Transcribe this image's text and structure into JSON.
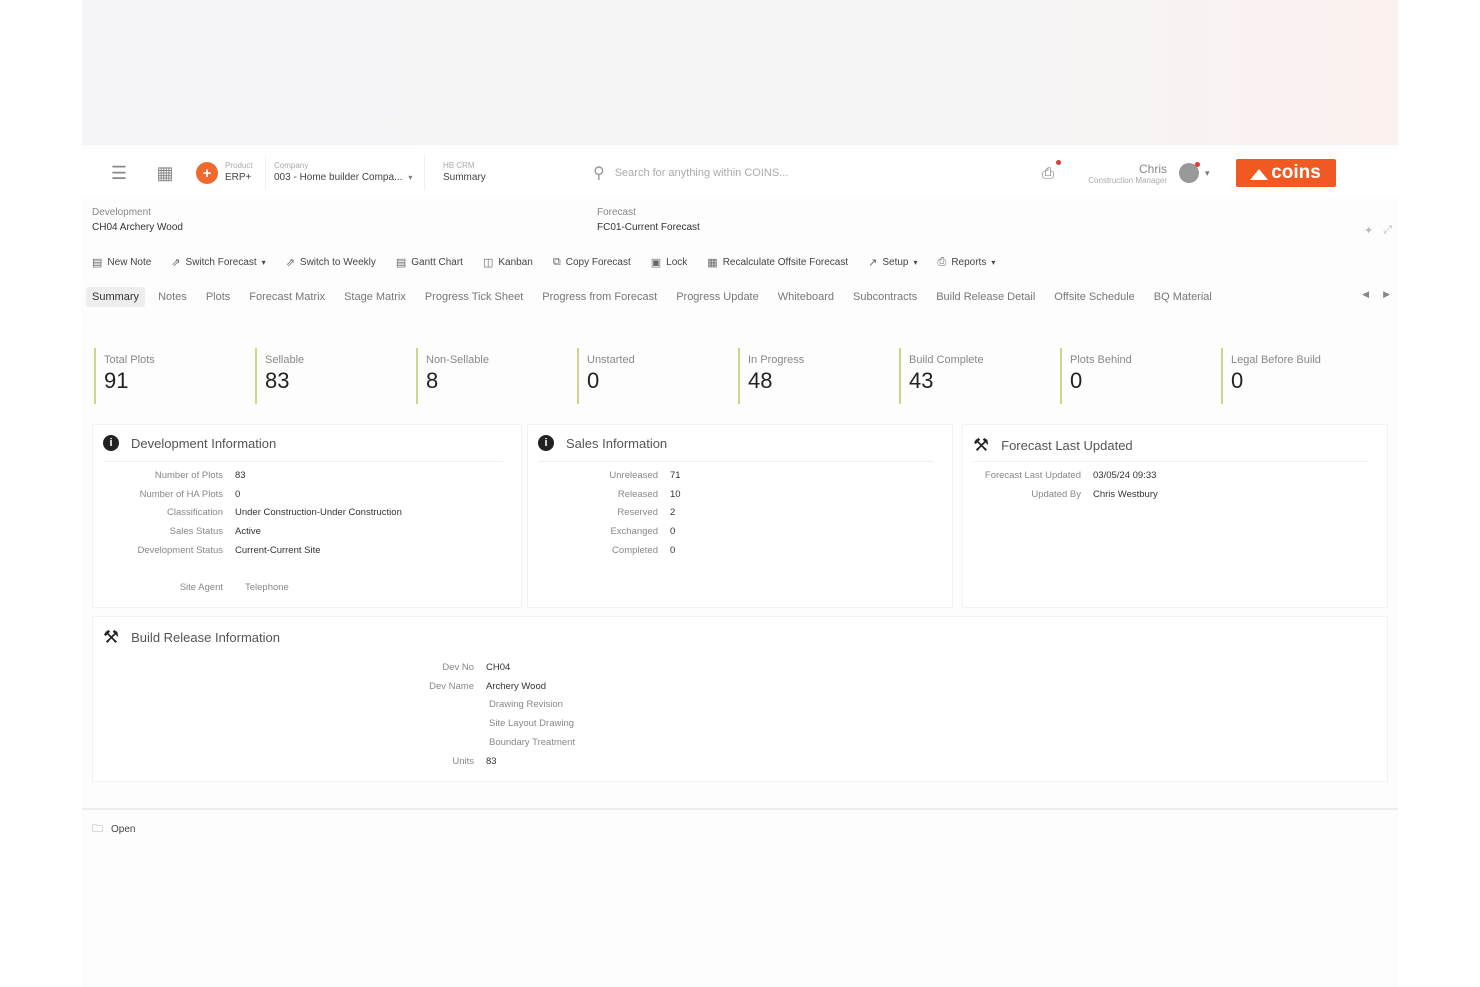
{
  "header": {
    "product_label": "Product",
    "product_value": "ERP+",
    "company_label": "Company",
    "company_value": "003 - Home builder Compa...",
    "crm_label": "HB CRM",
    "crm_value": "Summary",
    "search_placeholder": "Search for anything within COINS...",
    "user_name": "Chris",
    "user_role": "Construction Manager",
    "logo_text": "coins",
    "brand_color": "#f05a22"
  },
  "context": {
    "development_label": "Development",
    "development_value": "CH04 Archery Wood",
    "forecast_label": "Forecast",
    "forecast_value": "FC01-Current Forecast"
  },
  "toolbar": [
    {
      "label": "New Note",
      "icon": "note-icon"
    },
    {
      "label": "Switch Forecast",
      "icon": "external-link-icon",
      "caret": true
    },
    {
      "label": "Switch to Weekly",
      "icon": "external-link-icon"
    },
    {
      "label": "Gantt Chart",
      "icon": "gantt-icon"
    },
    {
      "label": "Kanban",
      "icon": "kanban-icon"
    },
    {
      "label": "Copy Forecast",
      "icon": "copy-icon"
    },
    {
      "label": "Lock",
      "icon": "lock-icon"
    },
    {
      "label": "Recalculate Offsite Forecast",
      "icon": "calculator-icon"
    },
    {
      "label": "Setup",
      "icon": "wrench-icon",
      "caret": true
    },
    {
      "label": "Reports",
      "icon": "print-icon",
      "caret": true
    }
  ],
  "tabs": [
    "Summary",
    "Notes",
    "Plots",
    "Forecast Matrix",
    "Stage Matrix",
    "Progress Tick Sheet",
    "Progress from Forecast",
    "Progress Update",
    "Whiteboard",
    "Subcontracts",
    "Build Release Detail",
    "Offsite Schedule",
    "BQ Material"
  ],
  "stats": [
    {
      "label": "Total Plots",
      "value": "91"
    },
    {
      "label": "Sellable",
      "value": "83"
    },
    {
      "label": "Non-Sellable",
      "value": "8"
    },
    {
      "label": "Unstarted",
      "value": "0"
    },
    {
      "label": "In Progress",
      "value": "48"
    },
    {
      "label": "Build Complete",
      "value": "43"
    },
    {
      "label": "Plots Behind",
      "value": "0"
    },
    {
      "label": "Legal Before Build",
      "value": "0"
    }
  ],
  "development_info": {
    "title": "Development Information",
    "rows": [
      {
        "k": "Number of Plots",
        "v": "83"
      },
      {
        "k": "Number of HA Plots",
        "v": "0"
      },
      {
        "k": "Classification",
        "v": "Under Construction-Under Construction"
      },
      {
        "k": "Sales Status",
        "v": "Active"
      },
      {
        "k": "Development Status",
        "v": "Current-Current Site"
      }
    ],
    "site_agent_label": "Site Agent",
    "telephone_label": "Telephone"
  },
  "sales_info": {
    "title": "Sales Information",
    "rows": [
      {
        "k": "Unreleased",
        "v": "71"
      },
      {
        "k": "Released",
        "v": "10"
      },
      {
        "k": "Reserved",
        "v": "2"
      },
      {
        "k": "Exchanged",
        "v": "0"
      },
      {
        "k": "Completed",
        "v": "0"
      }
    ]
  },
  "forecast_info": {
    "title": "Forecast Last Updated",
    "rows": [
      {
        "k": "Forecast Last Updated",
        "v": "03/05/24 09:33"
      },
      {
        "k": "Updated By",
        "v": "Chris Westbury"
      }
    ]
  },
  "build_release": {
    "title": "Build Release Information",
    "rows": [
      {
        "k": "Dev No",
        "v": "CH04"
      },
      {
        "k": "Dev Name",
        "v": "Archery Wood"
      },
      {
        "k": "",
        "v": "Drawing Revision"
      },
      {
        "k": "",
        "v": "Site Layout Drawing"
      },
      {
        "k": "",
        "v": "Boundary Treatment"
      },
      {
        "k": "Units",
        "v": "83"
      }
    ]
  },
  "footer": {
    "open_label": "Open"
  }
}
